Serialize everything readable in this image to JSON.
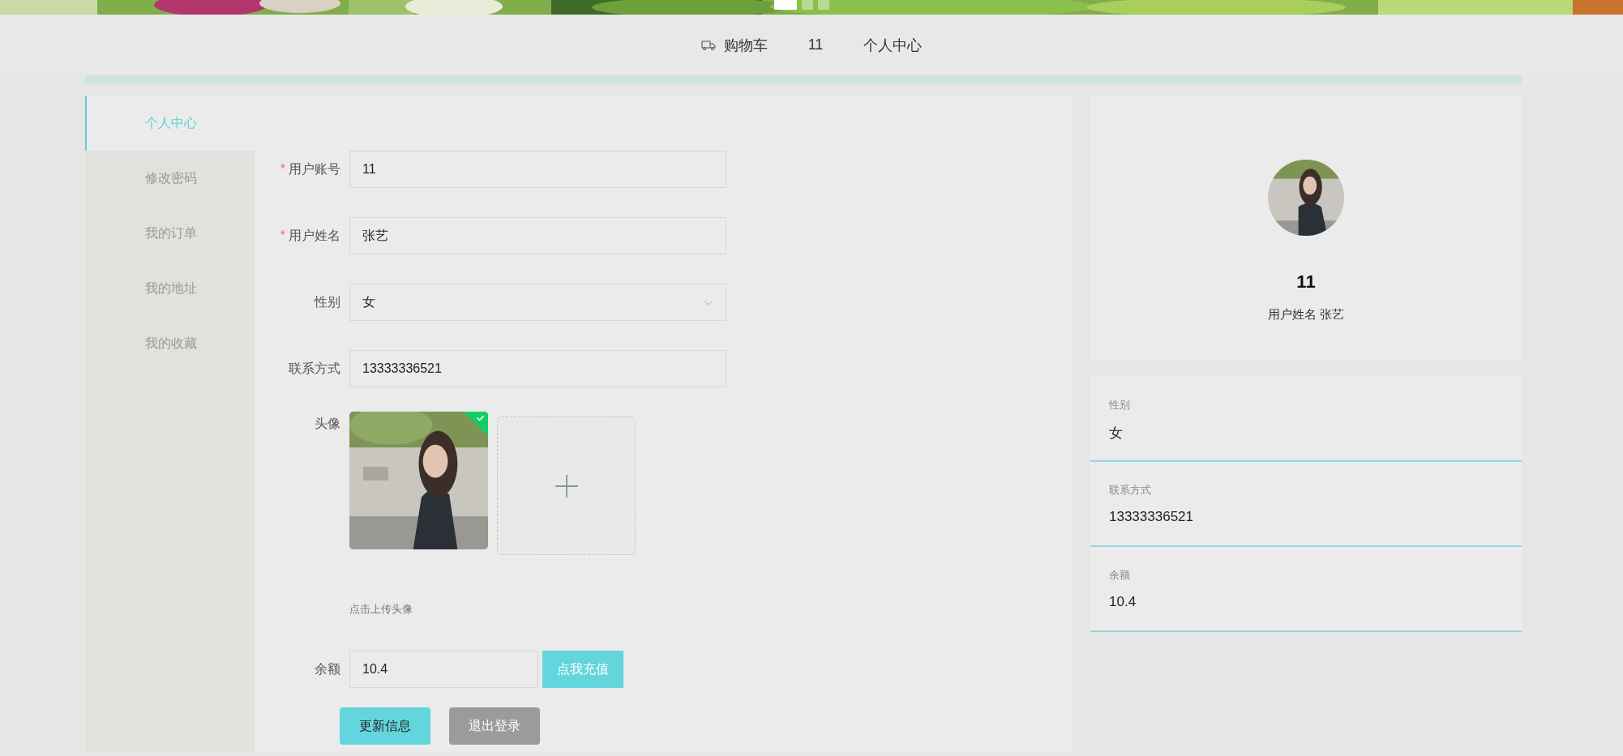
{
  "banner": {
    "kind": "picture",
    "dots": [
      {
        "selected": true
      },
      {
        "selected": false
      },
      {
        "selected": false
      }
    ]
  },
  "nav": {
    "items": [
      {
        "kind": "cart",
        "label": "购物车"
      },
      {
        "kind": "text",
        "label": "11"
      },
      {
        "kind": "text",
        "label": "个人中心"
      }
    ]
  },
  "sidebar": {
    "items": [
      {
        "label": "个人中心",
        "selected": true
      },
      {
        "label": "修改密码",
        "selected": false
      },
      {
        "label": "我的订单",
        "selected": false
      },
      {
        "label": "我的地址",
        "selected": false
      },
      {
        "label": "我的收藏",
        "selected": false
      }
    ]
  },
  "form": {
    "fields": [
      {
        "kind": "input",
        "mark": "*",
        "label": "用户账号",
        "value": "11"
      },
      {
        "kind": "input",
        "mark": "*",
        "label": "用户姓名",
        "value": "张艺"
      },
      {
        "kind": "select",
        "label": "性别",
        "value": "女"
      },
      {
        "kind": "input",
        "label": "联系方式",
        "value": "13333336521"
      },
      {
        "kind": "upload",
        "label": "头像",
        "uploaded": true,
        "hint": "点击上传头像"
      },
      {
        "kind": "balance",
        "label": "余额",
        "value": "10.4",
        "action": "点我充值"
      }
    ],
    "buttons": [
      {
        "kind": "primary",
        "label": "更新信息"
      },
      {
        "kind": "secondary",
        "label": "退出登录"
      }
    ]
  },
  "profile": {
    "name": "11",
    "subtitle": "用户姓名 张艺",
    "details": [
      {
        "label": "性别",
        "value": "女"
      },
      {
        "label": "联系方式",
        "value": "13333336521"
      },
      {
        "label": "余额",
        "value": "10.4"
      }
    ]
  }
}
